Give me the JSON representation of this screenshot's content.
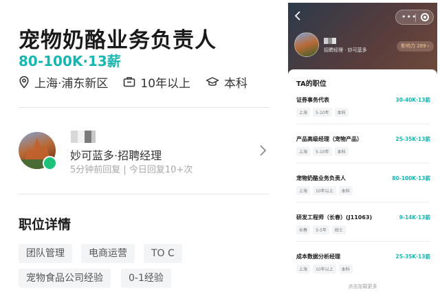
{
  "detail": {
    "title": "宠物奶酪业务负责人",
    "salary": "80-100K·13薪",
    "location": "上海·浦东新区",
    "experience": "10年以上",
    "education": "本科"
  },
  "recruiter": {
    "company_role": "妙可蓝多·招聘经理",
    "reply_status": "5分钟前回复 | 今日回复10+次"
  },
  "job_details": {
    "heading": "职位详情",
    "tags": [
      "团队管理",
      "电商运营",
      "TO C",
      "宠物食品公司经验",
      "0-1经验"
    ]
  },
  "profile": {
    "role": "招聘经理 · 妙可蓝多",
    "influence": "影响力 289 ›",
    "capsule_dots": "•••"
  },
  "positions": {
    "heading": "TA的职位",
    "items": [
      {
        "title": "证券事务代表",
        "salary": "30-40K·13薪",
        "tags": [
          "上海",
          "5-10年",
          "本科"
        ]
      },
      {
        "title": "产品高级经理（宠物产品）",
        "salary": "25-35K·13薪",
        "tags": [
          "上海",
          "5-10年",
          "本科"
        ]
      },
      {
        "title": "宠物奶酪业务负责人",
        "salary": "80-100K·13薪",
        "tags": [
          "上海",
          "10年以上",
          "本科"
        ]
      },
      {
        "title": "研发工程师（长春）(J11063)",
        "salary": "9-14K·13薪",
        "tags": [
          "长春",
          "3-5年",
          "硕士"
        ]
      },
      {
        "title": "成本数据分析经理",
        "salary": "25-35K·13薪",
        "tags": [
          "上海",
          "10年以上",
          "本科"
        ]
      }
    ],
    "load_more": "点击加载更多"
  },
  "colors": {
    "accent": "#17b6b0",
    "online": "#1ec37b"
  }
}
